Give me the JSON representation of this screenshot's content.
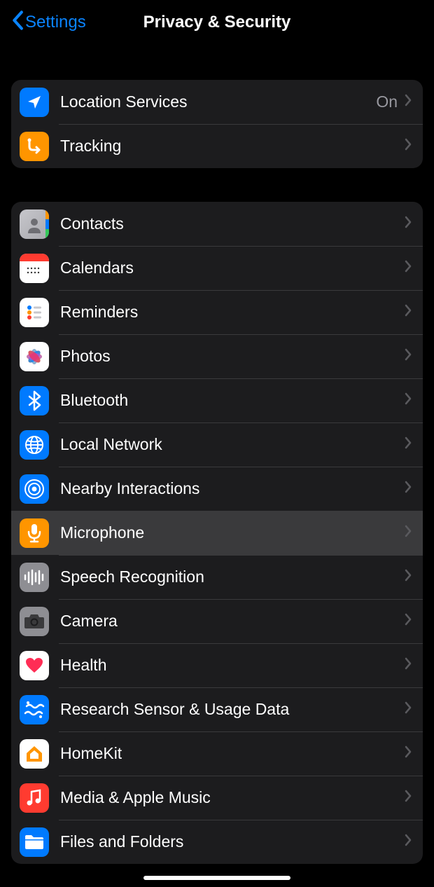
{
  "header": {
    "back_label": "Settings",
    "title": "Privacy & Security"
  },
  "group1": {
    "location": {
      "label": "Location Services",
      "value": "On"
    },
    "tracking": {
      "label": "Tracking"
    }
  },
  "group2": {
    "contacts": {
      "label": "Contacts"
    },
    "calendars": {
      "label": "Calendars"
    },
    "reminders": {
      "label": "Reminders"
    },
    "photos": {
      "label": "Photos"
    },
    "bluetooth": {
      "label": "Bluetooth"
    },
    "local_network": {
      "label": "Local Network"
    },
    "nearby": {
      "label": "Nearby Interactions"
    },
    "microphone": {
      "label": "Microphone",
      "highlighted": true
    },
    "speech": {
      "label": "Speech Recognition"
    },
    "camera": {
      "label": "Camera"
    },
    "health": {
      "label": "Health"
    },
    "research": {
      "label": "Research Sensor & Usage Data"
    },
    "homekit": {
      "label": "HomeKit"
    },
    "media": {
      "label": "Media & Apple Music"
    },
    "files": {
      "label": "Files and Folders"
    }
  }
}
